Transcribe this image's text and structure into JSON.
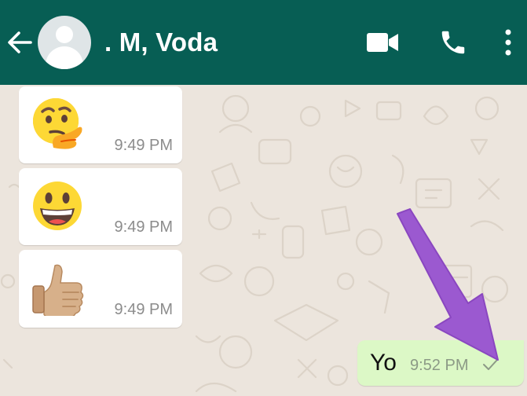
{
  "header": {
    "contact_name": ". M, Voda",
    "background_color": "#075e54",
    "icons": [
      "back-arrow-icon",
      "avatar",
      "video-camera-icon",
      "phone-icon",
      "more-options-icon"
    ]
  },
  "messages": [
    {
      "direction": "incoming",
      "content": "thinking-face-emoji",
      "time": "9:49 PM"
    },
    {
      "direction": "incoming",
      "content": "grinning-face-emoji",
      "time": "9:49 PM"
    },
    {
      "direction": "incoming",
      "content": "thumbs-up-emoji",
      "time": "9:49 PM"
    },
    {
      "direction": "outgoing",
      "text": "Yo",
      "time": "9:52 PM",
      "status": "sent-single-check"
    }
  ],
  "colors": {
    "chat_background": "#ece5dd",
    "incoming_bubble": "#ffffff",
    "outgoing_bubble": "#dcf8c6",
    "annotation_arrow": "#9b59d0"
  }
}
